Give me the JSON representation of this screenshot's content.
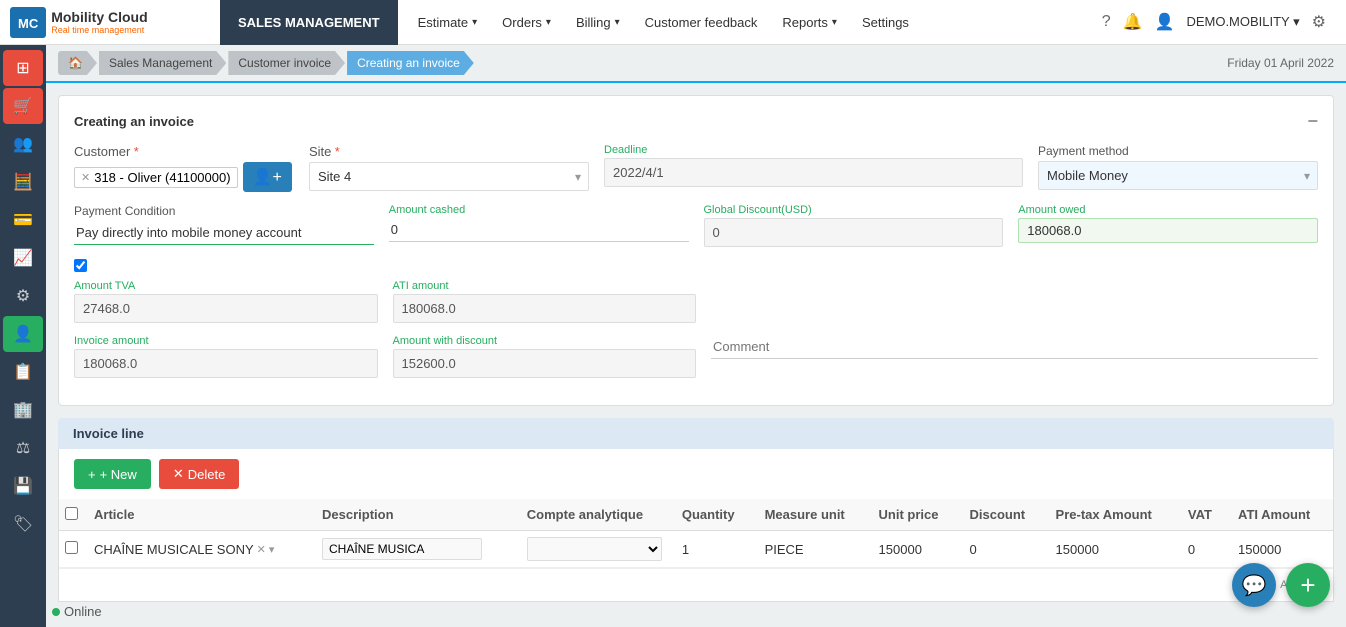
{
  "app": {
    "logo": "MC",
    "logo_sub": "Mobility Cloud",
    "logo_tagline": "Real time management",
    "nav_module": "SALES MANAGEMENT"
  },
  "nav": {
    "items": [
      {
        "label": "Estimate",
        "has_arrow": true
      },
      {
        "label": "Orders",
        "has_arrow": true
      },
      {
        "label": "Billing",
        "has_arrow": true
      },
      {
        "label": "Customer feedback",
        "has_arrow": false
      },
      {
        "label": "Reports",
        "has_arrow": true
      },
      {
        "label": "Settings",
        "has_arrow": false
      }
    ]
  },
  "nav_right": {
    "user": "DEMO.MOBILITY",
    "user_arrow": "▾"
  },
  "sidebar": {
    "items": [
      {
        "icon": "⊞",
        "type": "active"
      },
      {
        "icon": "🛒",
        "type": "orange"
      },
      {
        "icon": "👥",
        "type": "normal"
      },
      {
        "icon": "📊",
        "type": "normal"
      },
      {
        "icon": "💳",
        "type": "normal"
      },
      {
        "icon": "📈",
        "type": "normal"
      },
      {
        "icon": "⚙",
        "type": "normal"
      },
      {
        "icon": "👤",
        "type": "blue"
      },
      {
        "icon": "📋",
        "type": "normal"
      },
      {
        "icon": "🏢",
        "type": "normal"
      },
      {
        "icon": "⚖",
        "type": "normal"
      },
      {
        "icon": "💾",
        "type": "normal"
      },
      {
        "icon": "🔖",
        "type": "normal"
      }
    ]
  },
  "breadcrumb": {
    "date": "Friday 01 April 2022",
    "items": [
      {
        "label": "🏠",
        "active": false
      },
      {
        "label": "Sales Management",
        "active": false
      },
      {
        "label": "Customer invoice",
        "active": false
      },
      {
        "label": "Creating an invoice",
        "active": true
      }
    ]
  },
  "form": {
    "title": "Creating an invoice",
    "customer_label": "Customer",
    "customer_value": "318 - Oliver (41100000)",
    "site_label": "Site",
    "site_value": "Site 4",
    "deadline_label": "Deadline",
    "deadline_value": "2022/4/1",
    "payment_method_label": "Payment method",
    "payment_method_value": "Mobile Money",
    "payment_condition_label": "Payment Condition",
    "payment_condition_value": "Pay directly into mobile money account",
    "amount_cashed_label": "Amount cashed",
    "amount_cashed_value": "0",
    "global_discount_label": "Global Discount(USD)",
    "global_discount_value": "0",
    "amount_owed_label": "Amount owed",
    "amount_owed_value": "180068.0",
    "amount_tva_label": "Amount TVA",
    "amount_tva_value": "27468.0",
    "ati_amount_label": "ATI amount",
    "ati_amount_value": "180068.0",
    "invoice_amount_label": "Invoice amount",
    "invoice_amount_value": "180068.0",
    "amount_with_discount_label": "Amount with discount",
    "amount_with_discount_value": "152600.0",
    "comment_label": "Comment",
    "comment_placeholder": "Comment"
  },
  "invoice_line": {
    "title": "Invoice line",
    "btn_new": "+ New",
    "btn_delete": "✕ Delete",
    "table": {
      "headers": [
        "Article",
        "Description",
        "Compte analytique",
        "Quantity",
        "Measure unit",
        "Unit price",
        "Discount",
        "Pre-tax Amount",
        "VAT",
        "ATI Amount"
      ],
      "rows": [
        {
          "article": "CHAÎNE MUSICALE SONY",
          "description": "CHAÎNE MUSICA",
          "compte": "",
          "quantity": "1",
          "measure_unit": "PIECE",
          "unit_price": "150000",
          "discount": "0",
          "pretax": "150000",
          "vat": "0",
          "ati": "150000"
        }
      ]
    }
  },
  "bottom": {
    "amount_label": "Amount",
    "online_label": "Online"
  }
}
